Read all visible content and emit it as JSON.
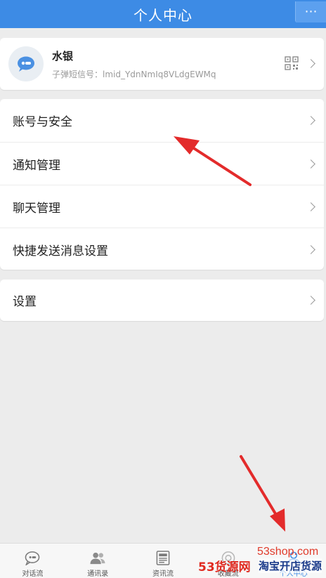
{
  "header": {
    "title": "个人中心",
    "more_label": "⋯"
  },
  "profile": {
    "name": "水银",
    "id_text": "子弹短信号：lmid_YdnNmIq8VLdgEWMq"
  },
  "menu": {
    "items": [
      {
        "label": "账号与安全"
      },
      {
        "label": "通知管理"
      },
      {
        "label": "聊天管理"
      },
      {
        "label": "快捷发送消息设置"
      }
    ]
  },
  "settings": {
    "label": "设置"
  },
  "tabbar": {
    "tabs": [
      {
        "label": "对话流",
        "icon": "chat-bubble-icon"
      },
      {
        "label": "通讯录",
        "icon": "contacts-icon"
      },
      {
        "label": "资讯流",
        "icon": "news-icon"
      },
      {
        "label": "收藏流",
        "icon": "favorites-icon"
      },
      {
        "label": "个人中心",
        "icon": "profile-icon"
      }
    ],
    "active": "个人中心"
  },
  "watermark": {
    "domain": "53shop.com",
    "brand": "53货源网",
    "sub": "淘宝开店货源"
  },
  "colors": {
    "header": "#3d8be5",
    "arrow": "#e32b2b",
    "active_tab": "#3d8be5"
  }
}
